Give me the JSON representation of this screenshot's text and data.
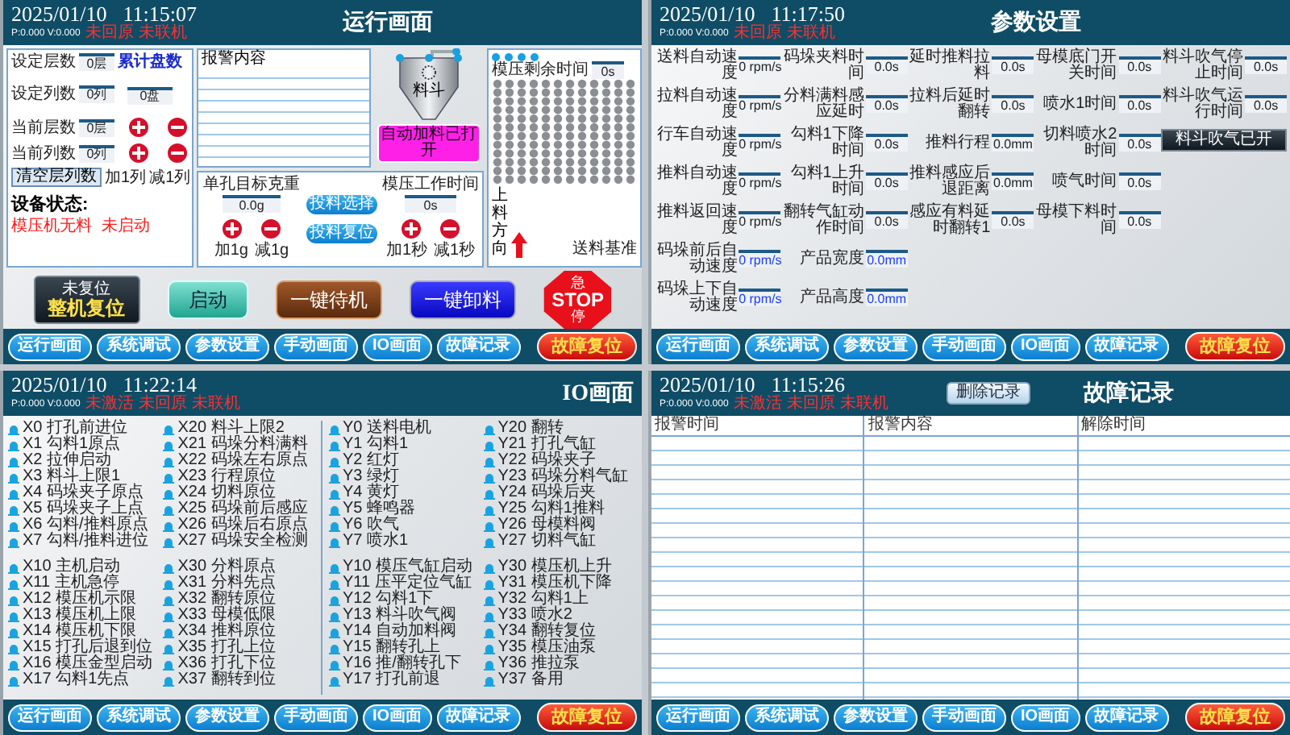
{
  "screens": [
    {
      "kind": "run",
      "header": {
        "date": "2025/01/10",
        "time": "11:15:07",
        "readout": "P:0.000 V:0.000",
        "alerts": [
          "未回原",
          "未联机"
        ],
        "title": "运行画面"
      },
      "run": {
        "counters": [
          {
            "label": "设定层数",
            "value": "0层"
          },
          {
            "label": "设定列数",
            "value": "0列"
          },
          {
            "label": "当前层数",
            "value": "0层"
          },
          {
            "label": "当前列数",
            "value": "0列"
          }
        ],
        "total": {
          "label": "累计盘数",
          "value": "0盘"
        },
        "col_adjust": [
          "加1列",
          "减1列"
        ],
        "clear_button": "清空层列数",
        "status": {
          "label": "设备状态:",
          "values": [
            "模压机无料",
            "未启动"
          ]
        },
        "alarm_list": {
          "title": "报警内容"
        },
        "hopper": {
          "label": "料斗",
          "auto_feed": "自动加料已打开"
        },
        "weight": {
          "label": "单孔目标克重",
          "value": "0.0g",
          "adjust": [
            "加1g",
            "减1g"
          ]
        },
        "feed_buttons": [
          "投料选择",
          "投料复位"
        ],
        "press_time": {
          "label": "模压工作时间",
          "value": "0s",
          "adjust": [
            "加1秒",
            "减1秒"
          ]
        },
        "grid": {
          "label": "模压剩余时间",
          "value": "0s",
          "direction": "上料方向",
          "base": "送料基准"
        },
        "actions": [
          {
            "kind": "reset",
            "caption": "未复位",
            "label": "整机复位"
          },
          {
            "kind": "start",
            "label": "启动"
          },
          {
            "kind": "standby",
            "label": "一键待机"
          },
          {
            "kind": "unload",
            "label": "一键卸料"
          },
          {
            "kind": "stop",
            "top": "急",
            "label": "STOP",
            "bottom": "停"
          }
        ]
      },
      "nav": {
        "buttons": [
          "运行画面",
          "系统调试",
          "参数设置",
          "手动画面",
          "IO画面",
          "故障记录"
        ],
        "reset": "故障复位"
      }
    },
    {
      "kind": "params",
      "header": {
        "date": "2025/01/10",
        "time": "11:17:50",
        "readout": "P:0.000 V:0.000",
        "alerts": [
          "未回原",
          "未联机"
        ],
        "title": "参数设置"
      },
      "params": {
        "columns": [
          [
            {
              "label": "送料自动速度",
              "value": "0 rpm/s",
              "highlight": false
            },
            {
              "label": "拉料自动速度",
              "value": "0 rpm/s",
              "highlight": false
            },
            {
              "label": "行车自动速度",
              "value": "0 rpm/s",
              "highlight": false
            },
            {
              "label": "推料自动速度",
              "value": "0 rpm/s",
              "highlight": false
            },
            {
              "label": "推料返回速度",
              "value": "0 rpm/s",
              "highlight": false
            },
            {
              "label": "码垛前后自动速度",
              "value": "0 rpm/s",
              "highlight": true
            },
            {
              "label": "码垛上下自动速度",
              "value": "0 rpm/s",
              "highlight": true
            }
          ],
          [
            {
              "label": "码垛夹料时间",
              "value": "0.0s",
              "highlight": false
            },
            {
              "label": "分料满料感应延时",
              "value": "0.0s",
              "highlight": false
            },
            {
              "label": "勾料1下降时间",
              "value": "0.0s",
              "highlight": false
            },
            {
              "label": "勾料1上升时间",
              "value": "0.0s",
              "highlight": false
            },
            {
              "label": "翻转气缸动作时间",
              "value": "0.0s",
              "highlight": false
            },
            {
              "label": "产品宽度",
              "value": "0.0mm",
              "highlight": true
            },
            {
              "label": "产品高度",
              "value": "0.0mm",
              "highlight": true
            }
          ],
          [
            {
              "label": "延时推料拉料",
              "value": "0.0s",
              "highlight": false
            },
            {
              "label": "拉料后延时翻转",
              "value": "0.0s",
              "highlight": false
            },
            {
              "label": "推料行程",
              "value": "0.0mm",
              "highlight": false
            },
            {
              "label": "推料感应后退距离",
              "value": "0.0mm",
              "highlight": false
            },
            {
              "label": "感应有料延时翻转1",
              "value": "0.0s",
              "highlight": false
            }
          ],
          [
            {
              "label": "母模底门开关时间",
              "value": "0.0s",
              "highlight": false
            },
            {
              "label": "喷水1时间",
              "value": "0.0s",
              "highlight": false
            },
            {
              "label": "切料喷水2时间",
              "value": "0.0s",
              "highlight": false
            },
            {
              "label": "喷气时间",
              "value": "0.0s",
              "highlight": false
            },
            {
              "label": "母模下料时间",
              "value": "0.0s",
              "highlight": false
            }
          ],
          [
            {
              "label": "料斗吹气停止时间",
              "value": "0.0s",
              "highlight": false
            },
            {
              "label": "料斗吹气运行时间",
              "value": "0.0s",
              "highlight": false
            }
          ]
        ],
        "button": "料斗吹气已开"
      },
      "nav": {
        "buttons": [
          "运行画面",
          "系统调试",
          "参数设置",
          "手动画面",
          "IO画面",
          "故障记录"
        ],
        "reset": "故障复位"
      }
    },
    {
      "kind": "io",
      "header": {
        "date": "2025/01/10",
        "time": "11:22:14",
        "readout": "P:0.000 V:0.000",
        "alerts": [
          "未激活",
          "未回原",
          "未联机"
        ],
        "title": "IO画面"
      },
      "io": {
        "columns": [
          [
            [
              "X0 打孔前进位",
              "X1 勾料1原点",
              "X2 拉伸启动",
              "X3 料斗上限1",
              "X4 码垛夹子原点",
              "X5 码垛夹子上点",
              "X6 勾料/推料原点",
              "X7 勾料/推料进位"
            ],
            [
              "X10 主机启动",
              "X11 主机急停",
              "X12 模压机示限",
              "X13 模压机上限",
              "X14 模压机下限",
              "X15 打孔后退到位",
              "X16 模压金型启动",
              "X17 勾料1先点"
            ]
          ],
          [
            [
              "X20 料斗上限2",
              "X21 码垛分料满料",
              "X22 码垛左右原点",
              "X23 行程原位",
              "X24 切料原位",
              "X25 码垛前后感应",
              "X26 码垛后右原点",
              "X27 码垛安全检测"
            ],
            [
              "X30 分料原点",
              "X31 分料先点",
              "X32 翻转原位",
              "X33 母模低限",
              "X34 推料原位",
              "X35 打孔上位",
              "X36 打孔下位",
              "X37 翻转到位"
            ]
          ],
          [
            [
              "Y0 送料电机",
              "Y1 勾料1",
              "Y2 红灯",
              "Y3 绿灯",
              "Y4 黄灯",
              "Y5 蜂鸣器",
              "Y6 吹气",
              "Y7 喷水1"
            ],
            [
              "Y10 模压气缸启动",
              "Y11 压平定位气缸",
              "Y12 勾料1下",
              "Y13 料斗吹气阀",
              "Y14 自动加料阀",
              "Y15 翻转孔上",
              "Y16 推/翻转孔下",
              "Y17 打孔前退"
            ]
          ],
          [
            [
              "Y20 翻转",
              "Y21 打孔气缸",
              "Y22 码垛夹子",
              "Y23 码垛分料气缸",
              "Y24 码垛后夹",
              "Y25 勾料1推料",
              "Y26 母模料阀",
              "Y27 切料气缸"
            ],
            [
              "Y30 模压机上升",
              "Y31 模压机下降",
              "Y32 勾料1上",
              "Y33 喷水2",
              "Y34 翻转复位",
              "Y35 模压油泵",
              "Y36 推拉泵",
              "Y37 备用"
            ]
          ]
        ]
      },
      "nav": {
        "buttons": [
          "运行画面",
          "系统调试",
          "参数设置",
          "手动画面",
          "IO画面",
          "故障记录"
        ],
        "reset": "故障复位"
      }
    },
    {
      "kind": "faults",
      "header": {
        "date": "2025/01/10",
        "time": "11:15:26",
        "readout": "P:0.000 V:0.000",
        "alerts": [
          "未激活",
          "未回原",
          "未联机"
        ],
        "title": "故障记录"
      },
      "faults": {
        "delete_button": "删除记录",
        "columns": [
          "报警时间",
          "报警内容",
          "解除时间"
        ]
      },
      "nav": {
        "buttons": [
          "运行画面",
          "系统调试",
          "参数设置",
          "手动画面",
          "IO画面",
          "故障记录"
        ],
        "reset": "故障复位"
      }
    }
  ]
}
